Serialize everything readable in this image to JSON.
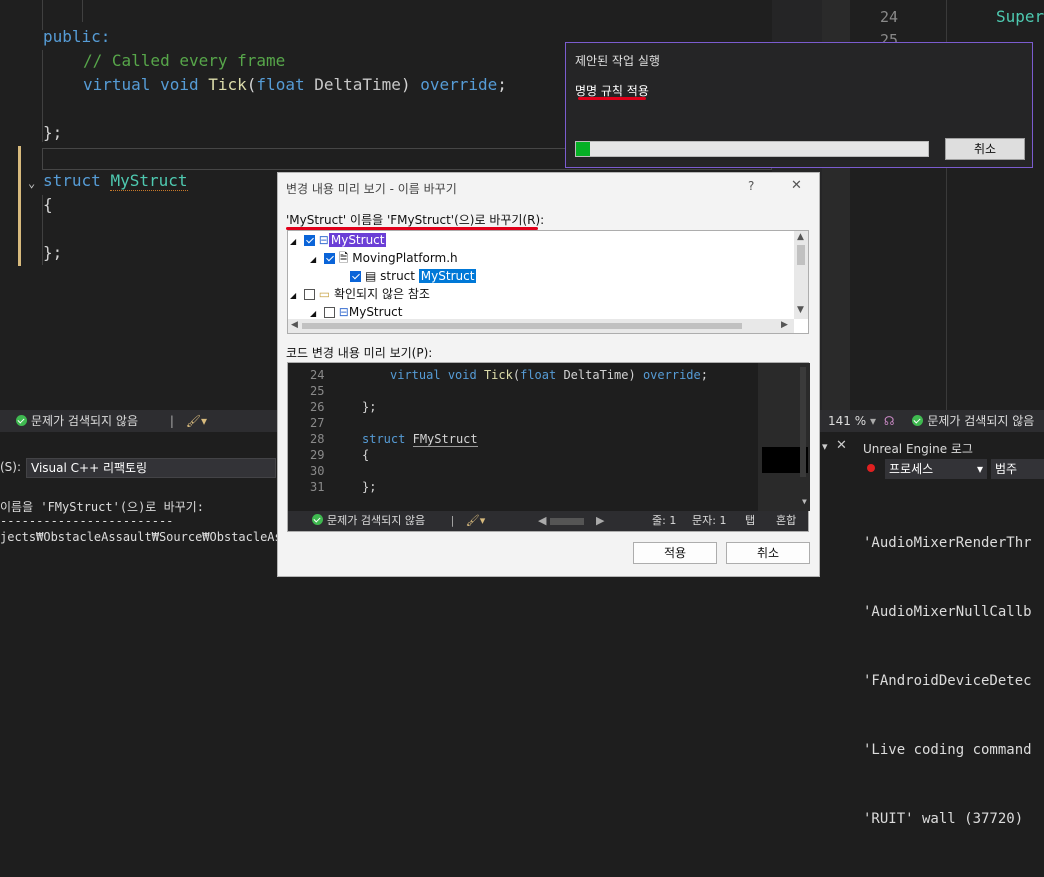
{
  "editor": {
    "lines": [
      {
        "kind": "public",
        "text": "public:"
      },
      {
        "kind": "comment",
        "text": "// Called every frame"
      },
      {
        "kind": "decl",
        "kw1": "virtual",
        "kw2": "void",
        "fn": "Tick",
        "p1": "(",
        "kw3": "float",
        "param": "DeltaTime",
        "p2": ")",
        "kw4": "override",
        "end": ";"
      },
      {
        "kind": "close",
        "text": "};"
      },
      {
        "kind": "struct",
        "kw": "struct",
        "name": "MyStruct"
      },
      {
        "kind": "brace",
        "text": "{"
      },
      {
        "kind": "close2",
        "text": "};"
      }
    ],
    "right_line_no": "24",
    "right_line_no2": "25",
    "right_code": "Super"
  },
  "progress_popup": {
    "title": "제안된 작업 실행",
    "subtitle": "명명 규칙 적용",
    "progress_percent": 4,
    "cancel": "취소"
  },
  "rename_dialog": {
    "title": "변경 내용 미리 보기 - 이름 바꾸기",
    "help": "?",
    "close": "✕",
    "header_label": "'MyStruct' 이름을 'FMyStruct'(으)로 바꾸기(R):",
    "tree": [
      {
        "label": "MyStruct",
        "checked": true
      },
      {
        "label": "MovingPlatform.h",
        "checked": true
      },
      {
        "prefix": "struct ",
        "label": "MyStruct",
        "checked": true
      },
      {
        "label": "확인되지 않은 참조",
        "checked": false
      },
      {
        "label": "MyStruct",
        "checked": false
      }
    ],
    "preview_label": "코드 변경 내용 미리 보기(P):",
    "preview_lines": [
      {
        "no": "24",
        "kw1": "virtual",
        "kw2": "void",
        "fn": "Tick",
        "p1": "(",
        "kw3": "float",
        "param": "DeltaTime",
        "p2": ")",
        "kw4": "override",
        "end": ";"
      },
      {
        "no": "25",
        "text": ""
      },
      {
        "no": "26",
        "text": "};"
      },
      {
        "no": "27",
        "text": ""
      },
      {
        "no": "28",
        "kw": "struct",
        "name": "FMyStruct"
      },
      {
        "no": "29",
        "text": "{"
      },
      {
        "no": "30",
        "text": ""
      },
      {
        "no": "31",
        "text": "};"
      }
    ],
    "preview_status": {
      "issues": "문제가 검색되지 않음",
      "line": "줄: 1",
      "col": "문자: 1",
      "tab": "탭",
      "eol": "혼합"
    },
    "apply": "적용",
    "cancel": "취소"
  },
  "status_left": {
    "issues": "문제가 검색되지 않음"
  },
  "status_right": {
    "zoom": "141 %",
    "issues": "문제가 검색되지 않음"
  },
  "output_panel": {
    "source_label": "(S):",
    "source_value": "Visual C++ 리팩토링",
    "line1": "이름을 'FMyStruct'(으)로 바꾸기:",
    "line2": "------------------------",
    "line3": "jects₩ObstacleAssault₩Source₩ObstacleAssault₩M"
  },
  "ue_panel": {
    "title": "Unreal Engine 로그",
    "process": "프로세스",
    "category": "범주",
    "logs": [
      "'AudioMixerRenderThr",
      "'AudioMixerNullCallb",
      "'FAndroidDeviceDetec",
      "'Live coding command",
      "'RUIT' wall (37720)"
    ]
  },
  "colors": {
    "accent": "#7b5ccf",
    "progress": "#06b025",
    "selection_dark": "#6b3fd6",
    "selection_blue": "#0078d7",
    "red_underline": "#e0001a"
  }
}
